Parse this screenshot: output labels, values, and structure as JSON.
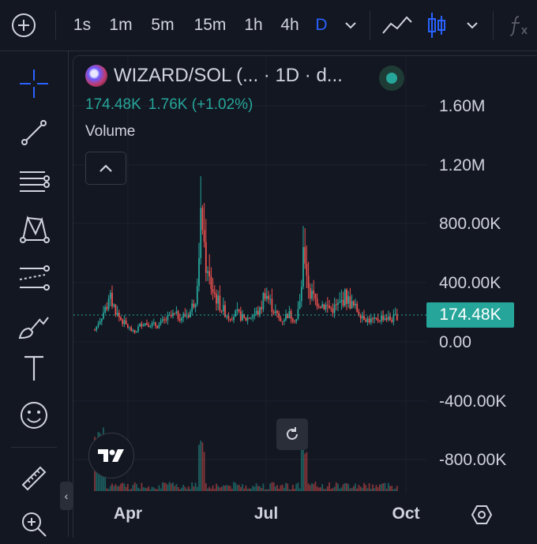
{
  "toolbar": {
    "intervals": [
      "1s",
      "1m",
      "5m",
      "15m",
      "1h",
      "4h",
      "D"
    ],
    "active_interval": "D",
    "icons": [
      "add-symbol-icon",
      "chevron-down-icon",
      "line-chart-icon",
      "candles-icon",
      "chevron-down-icon",
      "fx-icon"
    ],
    "colors": {
      "active": "#2962ff",
      "text": "#d1d4dc"
    }
  },
  "sidebar": {
    "tools": [
      "crosshair-icon",
      "trend-line-icon",
      "fib-lines-icon",
      "pattern-icon",
      "projection-icon",
      "brush-icon",
      "text-tool-icon",
      "emoji-icon",
      "ruler-icon",
      "zoom-in-icon"
    ]
  },
  "legend": {
    "title": "WIZARD/SOL (...   · 1D · d...",
    "close": "174.48K",
    "change": "1.76K (+1.02%)",
    "volume_label": "Volume"
  },
  "price_axis": {
    "labels": [
      "1.60M",
      "1.20M",
      "800.00K",
      "400.00K",
      "0.00",
      "-400.00K",
      "-800.00K"
    ],
    "last_price": "174.48K",
    "last_price_color": "#26a69a"
  },
  "time_axis": {
    "labels": [
      "Apr",
      "Jul",
      "Oct"
    ]
  },
  "colors": {
    "up": "#26a69a",
    "down": "#ef5350",
    "background": "#131722",
    "grid": "#1e222d"
  }
}
